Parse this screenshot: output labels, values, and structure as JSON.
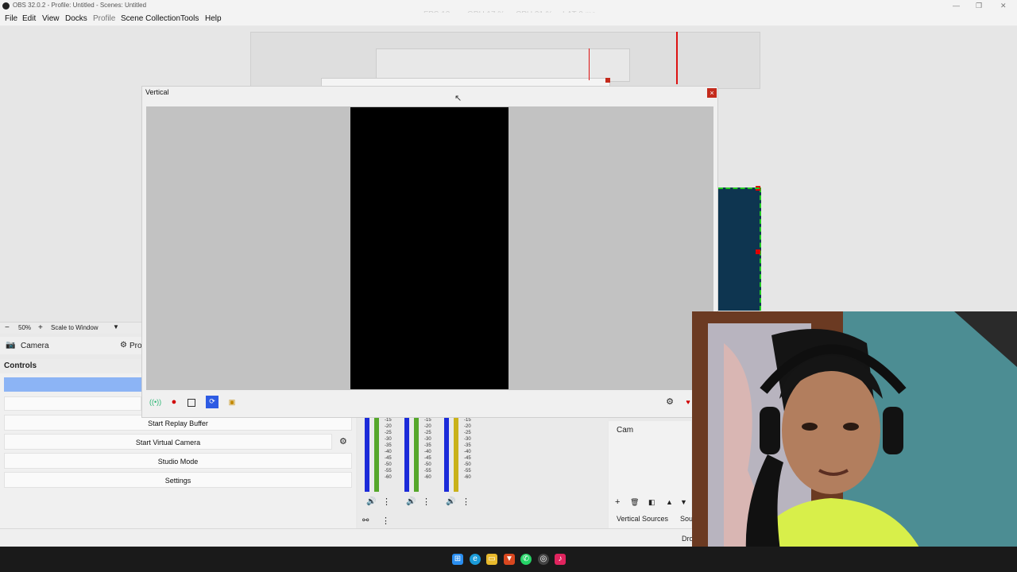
{
  "titlebar": {
    "title": "OBS 32.0.2 - Profile: Untitled - Scenes: Untitled",
    "minimize": "—",
    "restore": "❐",
    "close": "✕"
  },
  "stats": {
    "fps": "FPS  13",
    "gpu": "GPU  17 %",
    "cpu": "CPU  21 %",
    "lat": "LAT  0 ms"
  },
  "menu": [
    "File",
    "Edit",
    "View",
    "Docks",
    "Profile",
    "Scene Collection",
    "Tools",
    "Help"
  ],
  "zoom": {
    "minus": "−",
    "value": "50%",
    "plus": "+",
    "mode": "Scale to Window"
  },
  "source": {
    "name": "Camera",
    "properties": "Prop"
  },
  "controls": {
    "header": "Controls",
    "replay": "Start Replay Buffer",
    "virtual_cam": "Start Virtual Camera",
    "studio": "Studio Mode",
    "settings": "Settings"
  },
  "meter_ticks": [
    "-15",
    "-20",
    "-25",
    "-30",
    "-35",
    "-40",
    "-45",
    "-50",
    "-55",
    "-60"
  ],
  "sources_dock": {
    "item": "Cam",
    "tab_vertical": "Vertical Sources",
    "tab_other": "Sou"
  },
  "statusbar": {
    "right": "Dro"
  },
  "projector": {
    "title": "Vertical",
    "close": "×"
  },
  "colors": {
    "accent_blue": "#8cb4f5",
    "record_red": "#d00000",
    "frame_green": "#22c922"
  }
}
